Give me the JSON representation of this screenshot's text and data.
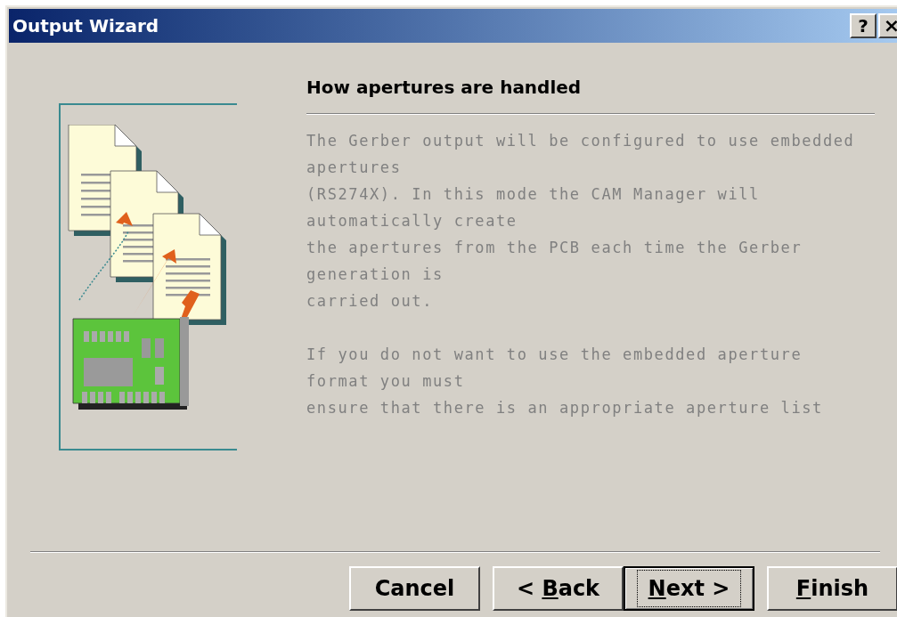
{
  "window": {
    "title": "Output Wizard",
    "help_button": "?",
    "close_button": "×"
  },
  "page": {
    "heading": "How apertures are handled",
    "paragraphs": [
      [
        "The Gerber output will be configured to use embedded",
        "apertures",
        "(RS274X). In this mode the CAM Manager will",
        "automatically create",
        "the apertures from the PCB each time the Gerber",
        "generation is",
        "carried out."
      ],
      [
        "If you do not want to use the embedded aperture",
        "format you must",
        "ensure that there is an appropriate aperture list"
      ]
    ],
    "disabled": true
  },
  "buttons": [
    {
      "after": "Cancel",
      "focused": false
    },
    {
      "before": "< ",
      "mnemonic": "B",
      "after": "ack",
      "focused": false
    },
    {
      "mnemonic": "N",
      "after": "ext >",
      "focused": true
    },
    {
      "mnemonic": "F",
      "after": "inish",
      "focused": false
    }
  ]
}
